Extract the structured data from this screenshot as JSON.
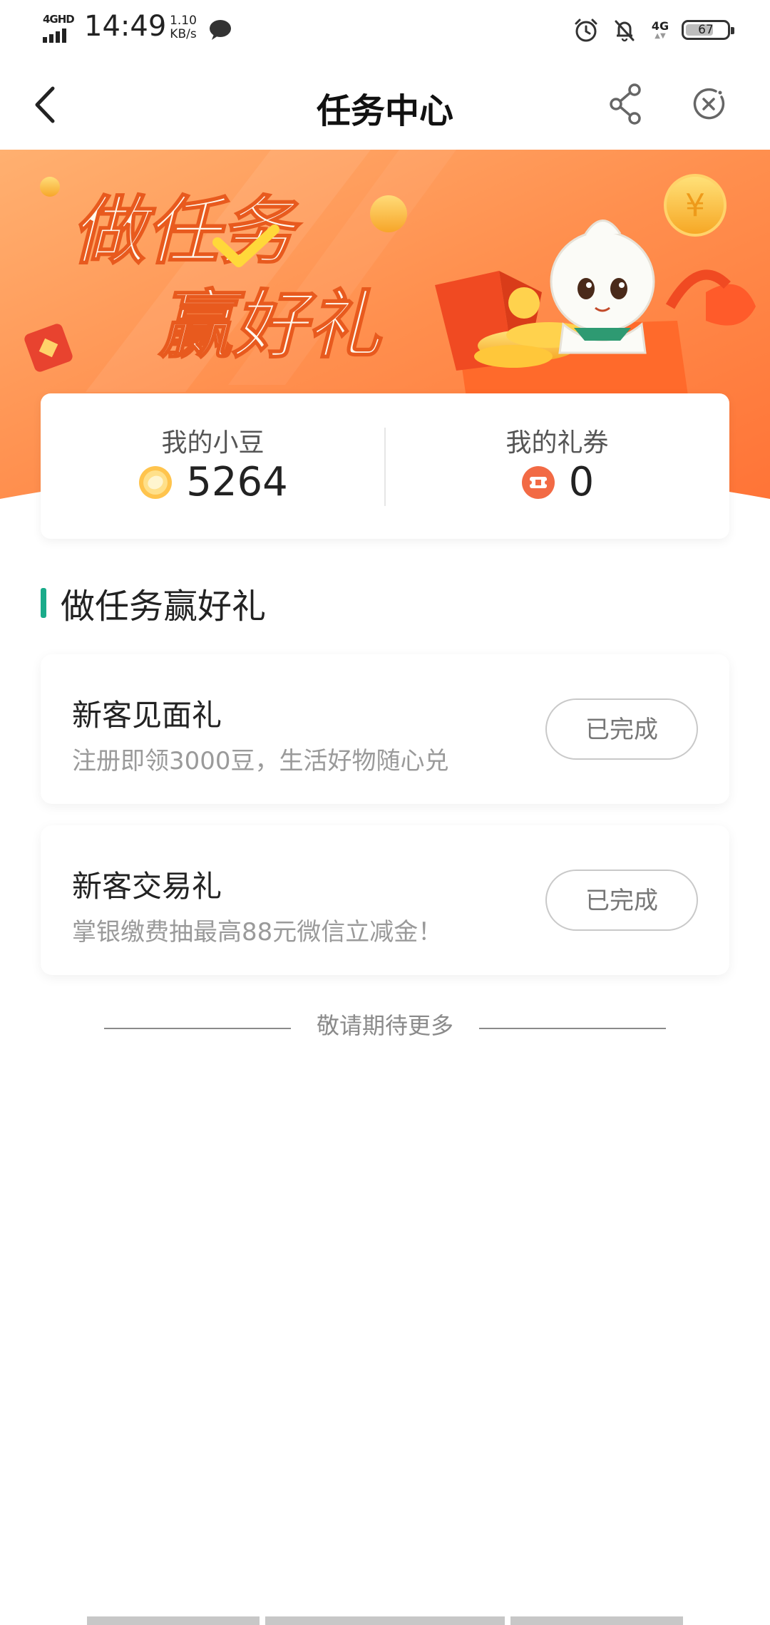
{
  "status_bar": {
    "network_label": "4GHD",
    "time": "14:49",
    "speed_value": "1.10",
    "speed_unit": "KB/s",
    "signal_right": "4G",
    "battery": "67",
    "battery_level": 0.67,
    "icons": [
      "signal-icon",
      "wechat-icon",
      "alarm-icon",
      "mute-bell-icon",
      "battery-icon"
    ]
  },
  "nav": {
    "title": "任务中心",
    "icons": [
      "back-arrow-icon",
      "share-icon",
      "close-miniprogram-icon"
    ]
  },
  "banner": {
    "headline_line1": "做任务",
    "headline_line2": "赢好礼",
    "colors": {
      "start": "#ff9f5a",
      "end": "#ff7a3d"
    }
  },
  "summary": {
    "beans_label": "我的小豆",
    "beans_value": "5264",
    "coupons_label": "我的礼券",
    "coupons_value": "0"
  },
  "section": {
    "title": "做任务赢好礼",
    "accent_color": "#1aab8a"
  },
  "tasks": [
    {
      "title": "新客见面礼",
      "desc": "注册即领3000豆，生活好物随心兑",
      "button": "已完成"
    },
    {
      "title": "新客交易礼",
      "desc": "掌银缴费抽最高88元微信立减金！",
      "button": "已完成"
    }
  ],
  "footer_note": "敬请期待更多"
}
